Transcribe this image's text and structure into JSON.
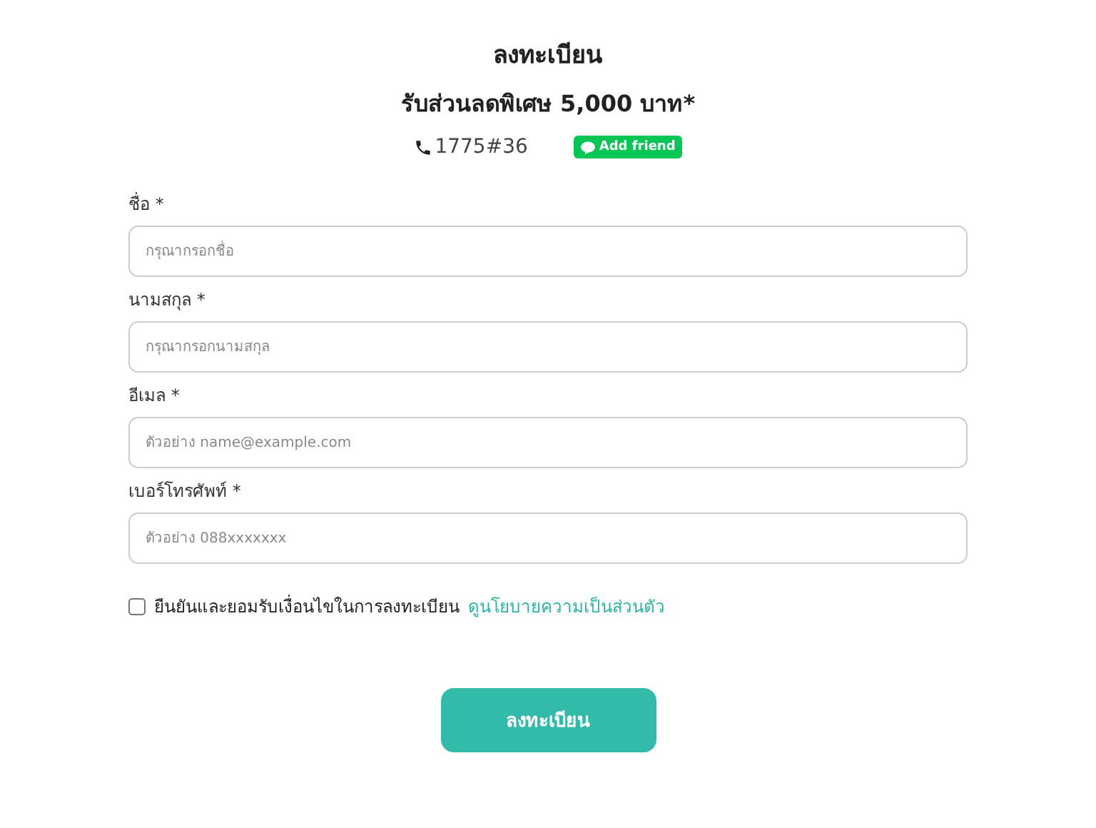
{
  "title": "ลงทะเบียน",
  "subtitle": "รับส่วนลดพิเศษ 5,000 บาท*",
  "phone": "1775#36",
  "add_friend": "Add friend",
  "fields": [
    {
      "label": "ชื่อ *",
      "placeholder": "กรุณากรอกชื่อ"
    },
    {
      "label": "นามสกุล *",
      "placeholder": "กรุณากรอกนามสกุล"
    },
    {
      "label": "อีเมล *",
      "placeholder": "ตัวอย่าง name@example.com"
    },
    {
      "label": "เบอร์โทรศัพท์ *",
      "placeholder": "ตัวอย่าง 088xxxxxxx"
    }
  ],
  "consent": {
    "checked": false,
    "text": "ยืนยันและยอมรับเงื่อนไขในการลงทะเบียน",
    "link": "ดูนโยบายความเป็นส่วนตัว"
  },
  "submit": "ลงทะเบียน"
}
